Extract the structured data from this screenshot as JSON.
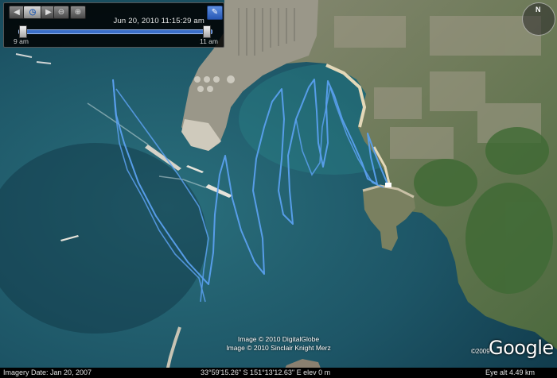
{
  "timebar": {
    "date_time": "Jun 20, 2010  11:15:29 am",
    "start_label": "9 am",
    "end_label": "11 am",
    "icons": [
      "back-icon",
      "clock-icon",
      "forward-icon",
      "zoom-out-icon",
      "zoom-in-icon",
      "wrench-icon"
    ]
  },
  "compass": {
    "north": "N"
  },
  "attribution": {
    "line1": "Image © 2010 DigitalGlobe",
    "line2": "Image © 2010 Sinclair Knight Merz"
  },
  "logo": {
    "year": "©2009",
    "brand": "Google"
  },
  "status": {
    "imagery_date": "Imagery Date: Jan 20, 2007",
    "coords": "33°59'15.26\" S   151°13'12.63\" E    elev   0 m",
    "eye_alt": "Eye alt     4.49 km"
  },
  "colors": {
    "track": "#5aa0ee",
    "sea": "#1f5a6a",
    "land": "#6f7a5a",
    "sand": "#e4d8b8"
  }
}
